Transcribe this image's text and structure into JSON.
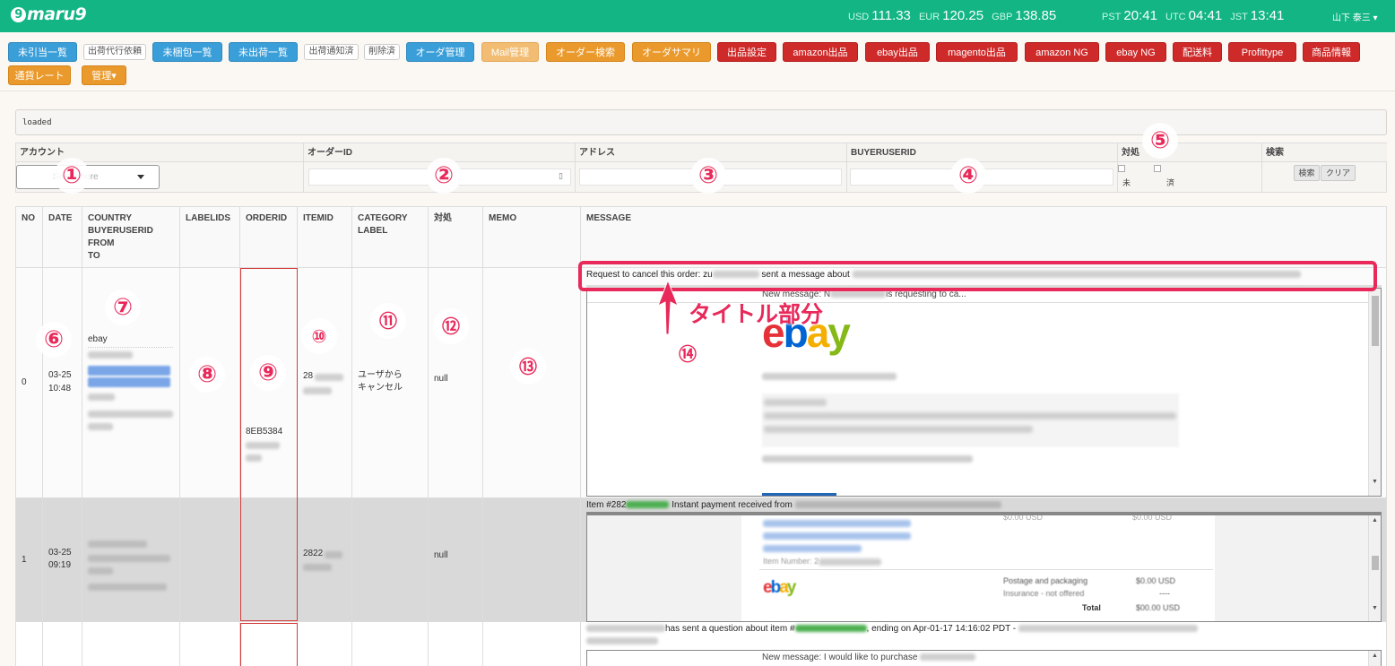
{
  "header": {
    "logo": "maru9",
    "rates": [
      {
        "code": "USD",
        "value": "111.33"
      },
      {
        "code": "EUR",
        "value": "120.25"
      },
      {
        "code": "GBP",
        "value": "138.85"
      }
    ],
    "times": [
      {
        "code": "PST",
        "value": "20:41"
      },
      {
        "code": "UTC",
        "value": "04:41"
      },
      {
        "code": "JST",
        "value": "13:41"
      }
    ],
    "user": "山下 泰三 ▾"
  },
  "toolbar": {
    "buttons": [
      {
        "label": "未引当一覧",
        "style": "blue"
      },
      {
        "label": "出荷代行依頼",
        "style": "white"
      },
      {
        "label": "未梱包一覧",
        "style": "blue"
      },
      {
        "label": "未出荷一覧",
        "style": "blue"
      },
      {
        "label": "出荷通知済",
        "style": "white"
      },
      {
        "label": "削除済",
        "style": "white"
      },
      {
        "label": "オーダ管理",
        "style": "blue"
      },
      {
        "label": "Mail管理",
        "style": "orangel"
      },
      {
        "label": "オーダー検索",
        "style": "orange"
      },
      {
        "label": "オーダサマリ",
        "style": "orange"
      },
      {
        "label": "出品設定",
        "style": "red"
      },
      {
        "label": "amazon出品",
        "style": "red"
      },
      {
        "label": "ebay出品",
        "style": "red"
      },
      {
        "label": "magento出品",
        "style": "red"
      },
      {
        "label": "amazon NG",
        "style": "red"
      },
      {
        "label": "ebay NG",
        "style": "red"
      },
      {
        "label": "配送料",
        "style": "red"
      },
      {
        "label": "Profittype",
        "style": "red"
      },
      {
        "label": "商品情報",
        "style": "red"
      },
      {
        "label": "通貨レート",
        "style": "orange"
      },
      {
        "label": "管理▾",
        "style": "orange"
      }
    ]
  },
  "status": {
    "text": "loaded"
  },
  "search": {
    "headers": {
      "account": "アカウント",
      "order_id": "オーダーID",
      "address": "アドレス",
      "buyer": "BUYERUSERID",
      "handled": "対処",
      "search": "検索"
    },
    "account_placeholder": "Select here",
    "check_unhandled": "未",
    "check_handled": "済",
    "search_button": "検索",
    "clear_button": "クリア"
  },
  "table": {
    "headers": {
      "no": "NO",
      "date": "DATE",
      "country": "COUNTRY",
      "buyer": "BUYERUSERID",
      "from": "FROM",
      "to": "TO",
      "labelids": "LABELIDS",
      "orderid": "ORDERID",
      "itemid": "ITEMID",
      "category": "CATEGORY",
      "label": "LABEL",
      "handled": "対処",
      "memo": "MEMO",
      "message": "MESSAGE"
    },
    "rows": [
      {
        "no": "0",
        "date": "03-25",
        "time": "10:48",
        "country": "ebay",
        "buyer": "zu",
        "order_id": "8EB5384",
        "item_id": "28",
        "category": "ユーザから",
        "category2": "キャンセル",
        "handled": "null",
        "title_prefix": "Request to cancel this order: zu",
        "title_mid": "sent a message about",
        "preview": "New message: N",
        "preview2": "is requesting to ca..."
      },
      {
        "no": "1",
        "date": "03-25",
        "time": "09:19",
        "item_id": "2822",
        "handled": "null",
        "title_prefix": "Item #282",
        "title_mid": "Instant payment re",
        "title_end": "ceived from",
        "email_item": "Item Number: 2",
        "email_postage": "Postage and packaging",
        "email_insurance": "Insurance - not offered",
        "email_total": "Total",
        "amount1": "$0.00 USD",
        "amount2": "----",
        "amount3": "$00.00 USD"
      },
      {
        "title_prefix": "has sent a question about item #",
        "title_mid": ", ending on Apr-01-17 14:16:02 PDT -",
        "preview": "New message: I would like to purchase"
      }
    ]
  },
  "annotations": {
    "markers": [
      "①",
      "②",
      "③",
      "④",
      "⑤",
      "⑥",
      "⑦",
      "⑧",
      "⑨",
      "⑩",
      "⑪",
      "⑫",
      "⑬",
      "⑭"
    ],
    "callout": "タイトル部分",
    "color": "#e8295a"
  }
}
